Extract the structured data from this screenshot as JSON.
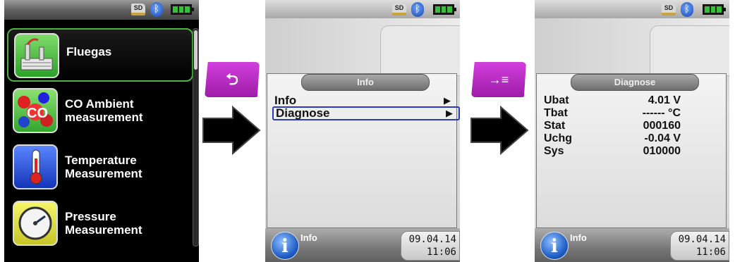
{
  "menu_screen": {
    "status": {
      "sd_label": "SD",
      "bluetooth_symbol": "ᛒ"
    },
    "items": [
      {
        "label_line1": "Fluegas",
        "label_line2": "",
        "icon": "factory-icon",
        "selected": true
      },
      {
        "label_line1": "CO Ambient",
        "label_line2": "measurement",
        "icon": "molecule-icon",
        "selected": false
      },
      {
        "label_line1": "Temperature",
        "label_line2": "Measurement",
        "icon": "thermometer-icon",
        "selected": false
      },
      {
        "label_line1": "Pressure",
        "label_line2": "Measurement",
        "icon": "gauge-icon",
        "selected": false
      }
    ]
  },
  "buttons": {
    "back_symbol": "⮌",
    "enter_symbol": "→≡",
    "back_color": "#c12fcc",
    "arrow_color": "#000000"
  },
  "info_screen": {
    "status": {
      "sd_label": "SD",
      "bluetooth_symbol": "ᛒ"
    },
    "header": "Info",
    "rows": [
      {
        "label": "Info",
        "arrow": "▶",
        "selected": false
      },
      {
        "label": "Diagnose",
        "arrow": "▶",
        "selected": true
      }
    ],
    "bottom": {
      "info_glyph": "i",
      "title": "Info",
      "date": "09.04.14",
      "time": "11:06"
    }
  },
  "diagnose_screen": {
    "status": {
      "sd_label": "SD",
      "bluetooth_symbol": "ᛒ"
    },
    "header": "Diagnose",
    "rows": [
      {
        "label": "Ubat",
        "value": "4.01 V"
      },
      {
        "label": "Tbat",
        "value": "------ °C"
      },
      {
        "label": "Stat",
        "value": "000160"
      },
      {
        "label": "Uchg",
        "value": "-0.04 V"
      },
      {
        "label": "Sys",
        "value": "010000"
      }
    ],
    "bottom": {
      "info_glyph": "i",
      "title": "Info",
      "date": "09.04.14",
      "time": "11:06"
    }
  }
}
